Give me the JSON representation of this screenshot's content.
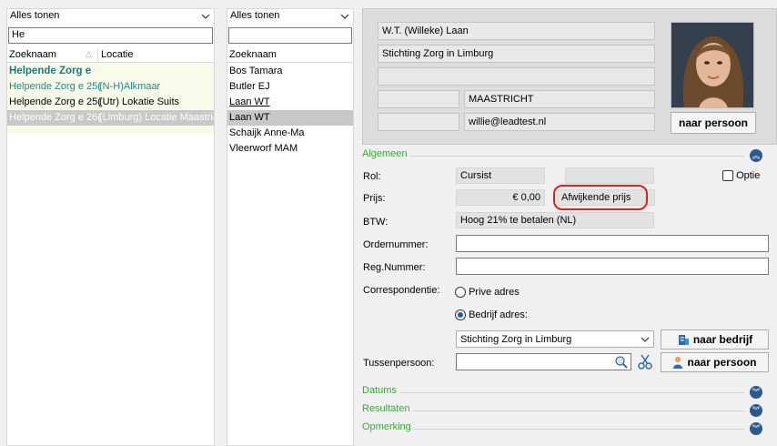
{
  "left_panel": {
    "filter": "Alles tonen",
    "search_value": "He",
    "columns": [
      "Zoeknaam",
      "Locatie"
    ],
    "rows": [
      {
        "name": "Helpende Zorg e",
        "location": "",
        "style": "group"
      },
      {
        "name": "Helpende Zorg e 25(",
        "location": "(N-H)Alkmaar",
        "style": "teal"
      },
      {
        "name": "Helpende Zorg e 25(",
        "location": "(Utr) Lokatie Suits",
        "style": "normal"
      },
      {
        "name": "Helpende Zorg e 26(",
        "location": "(Limburg) Locatie Maastricht",
        "style": "selected"
      }
    ]
  },
  "middle_panel": {
    "filter": "Alles tonen",
    "search_value": "",
    "column": "Zoeknaam",
    "rows": [
      {
        "name": "Bos Tamara",
        "style": "normal"
      },
      {
        "name": "Butler EJ",
        "style": "normal"
      },
      {
        "name": "Laan WT",
        "style": "underline"
      },
      {
        "name": "Laan WT",
        "style": "selected"
      },
      {
        "name": "Schaijk Anne-Ma",
        "style": "normal"
      },
      {
        "name": "Vleerworf MAM",
        "style": "normal"
      }
    ]
  },
  "person_card": {
    "name": "W.T. (Willeke) Laan",
    "organization": "Stichting Zorg in Limburg",
    "address": "",
    "postcode": "",
    "city": "MAASTRICHT",
    "phone": "",
    "email": "willie@leadtest.nl",
    "naar_persoon_label": "naar persoon"
  },
  "sections": {
    "algemeen": "Algemeen",
    "datums": "Datums",
    "resultaten": "Resultaten",
    "opmerking": "Opmerking"
  },
  "form": {
    "rol_label": "Rol:",
    "rol_value": "Cursist",
    "optie_label": "Optie",
    "prijs_label": "Prijs:",
    "prijs_value": "€ 0,00",
    "afwijkende_prijs": "Afwijkende prijs",
    "btw_label": "BTW:",
    "btw_value": "Hoog 21% te betalen (NL)",
    "ordernummer_label": "Ordernummer:",
    "regnummer_label": "Reg.Nummer:",
    "correspondentie_label": "Correspondentie:",
    "prive_adres_label": "Prive adres",
    "bedrijf_adres_label": "Bedrijf adres:",
    "bedrijf_select": "Stichting Zorg in Limburg",
    "naar_bedrijf_label": "naar bedrijf",
    "tussenpersoon_label": "Tussenpersoon:",
    "naar_persoon_label": "naar persoon"
  }
}
